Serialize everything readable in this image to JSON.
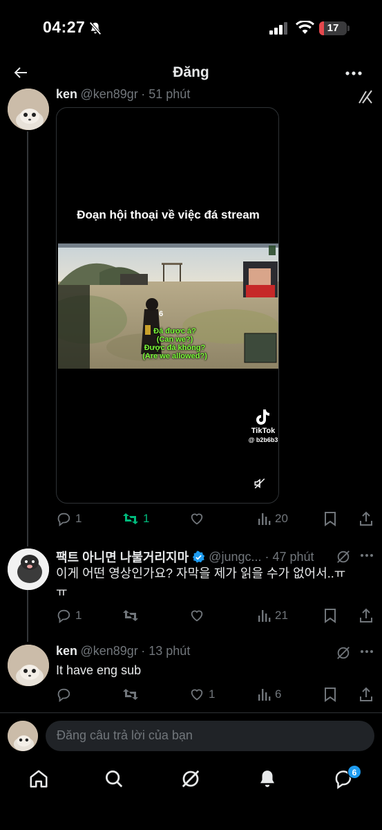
{
  "status_bar": {
    "time": "04:27",
    "battery": "17",
    "battery_level": 0.17
  },
  "header": {
    "title": "Đăng"
  },
  "tweets": [
    {
      "name": "ken",
      "handle": "@ken89gr",
      "time": "· 51 phút",
      "video": {
        "caption": "Đoạn hội thoại về việc đá stream",
        "subtitle_1": "Đá được á?",
        "subtitle_1_en": "(Can we?)",
        "subtitle_2": "Được đá không?",
        "subtitle_2_en": "(Are we allowed?)",
        "hud_number": "6",
        "tiktok_label": "TikTok",
        "tiktok_user": "@ b2b6b3"
      },
      "replies": "1",
      "reposts": "1",
      "likes": "",
      "views": "20"
    },
    {
      "name": "팩트 아니면 나불거리지마",
      "handle": "@jungc...",
      "time": "· 47 phút",
      "text_line1": "이게 어떤 영상인가요? 자막을 제가 읽을 수가 없어서..ㅠ",
      "text_line2": "ㅠ",
      "replies": "1",
      "reposts": "",
      "likes": "",
      "views": "21"
    },
    {
      "name": "ken",
      "handle": "@ken89gr",
      "time": "· 13 phút",
      "text": "It have eng sub",
      "replies": "",
      "reposts": "",
      "likes": "1",
      "views": "6"
    }
  ],
  "reply_box": {
    "placeholder": "Đăng câu trả lời của bạn"
  },
  "bottom_nav": {
    "messages_badge": "6"
  },
  "colors": {
    "background": "#000000",
    "text": "#e7e9ea",
    "muted": "#71767b",
    "repost_active": "#00ba7c",
    "verified": "#1d9bf0",
    "badge": "#1d9bf0"
  }
}
